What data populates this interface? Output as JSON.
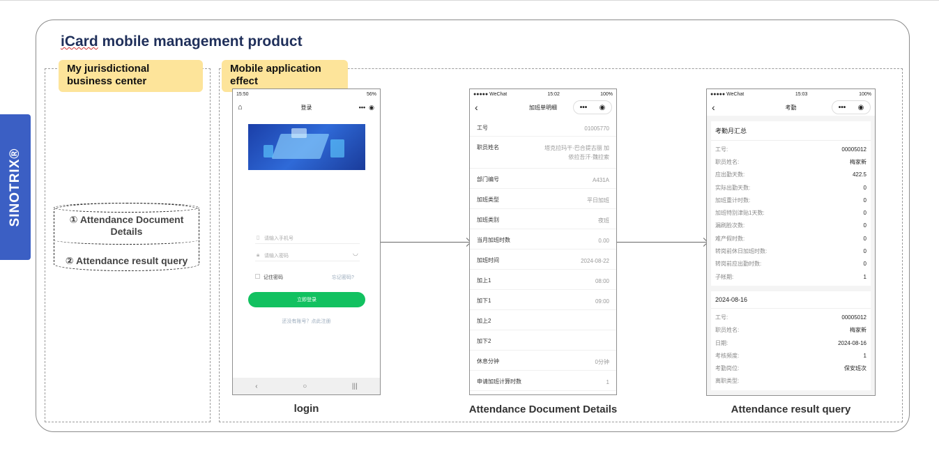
{
  "brand": "SINOTRIX®",
  "title_part1": "iCard",
  "title_part2": " mobile management product",
  "tags": {
    "left": "My jurisdictional business center",
    "right": "Mobile application effect"
  },
  "database": {
    "item1": "① Attendance Document Details",
    "item2": "② Attendance result query"
  },
  "captions": {
    "login": "login",
    "details": "Attendance Document Details",
    "query": "Attendance result query"
  },
  "login_phone": {
    "status_left": "15:50",
    "status_right": "56%",
    "page_title": "登录",
    "phone_placeholder": "请输入手机号",
    "password_placeholder": "请输入密码",
    "remember": "记住密码",
    "forgot": "忘记密码?",
    "login_button": "立即登录",
    "register": "还没有账号？点此注册"
  },
  "details_phone": {
    "carrier": "●●●●● WeChat",
    "time": "15:02",
    "battery": "100%",
    "page_title": "加班单明细",
    "rows": [
      {
        "label": "工号",
        "value": "01005770"
      },
      {
        "label": "职员姓名",
        "value": "塔克拉玛干·巴合提古丽 加依拉吾汗·魏拉索"
      },
      {
        "label": "部门编号",
        "value": "A431A"
      },
      {
        "label": "加班类型",
        "value": "平日加班"
      },
      {
        "label": "加班类别",
        "value": "夜班"
      },
      {
        "label": "当月加班时数",
        "value": "0.00"
      },
      {
        "label": "加班时间",
        "value": "2024-08-22"
      },
      {
        "label": "加上1",
        "value": "08:00"
      },
      {
        "label": "加下1",
        "value": "09:00"
      },
      {
        "label": "加上2",
        "value": ""
      },
      {
        "label": "加下2",
        "value": ""
      },
      {
        "label": "休息分钟",
        "value": "0分钟"
      },
      {
        "label": "申请加班计算时数",
        "value": "1"
      }
    ]
  },
  "query_phone": {
    "carrier": "●●●●● WeChat",
    "time": "15:03",
    "battery": "100%",
    "page_title": "考勤",
    "summary_title": "考勤月汇总",
    "summary": [
      {
        "label": "工号:",
        "value": "00005012"
      },
      {
        "label": "职员姓名:",
        "value": "梅家新"
      },
      {
        "label": "应出勤天数:",
        "value": "422.5"
      },
      {
        "label": "实际出勤天数:",
        "value": "0"
      },
      {
        "label": "加班重计时数:",
        "value": "0"
      },
      {
        "label": "加班特别津贴1天数:",
        "value": "0"
      },
      {
        "label": "漏刷脸次数:",
        "value": "0"
      },
      {
        "label": "难产假时数:",
        "value": "0"
      },
      {
        "label": "转岗前休日加班时数:",
        "value": "0"
      },
      {
        "label": "转岗前应出勤时数:",
        "value": "0"
      },
      {
        "label": "子帐期:",
        "value": "1"
      }
    ],
    "day_title": "2024-08-16",
    "day": [
      {
        "label": "工号:",
        "value": "00005012"
      },
      {
        "label": "职员姓名:",
        "value": "梅家新"
      },
      {
        "label": "日期:",
        "value": "2024-08-16"
      },
      {
        "label": "考核频度:",
        "value": "1"
      },
      {
        "label": "考勤岗位:",
        "value": "保安班次"
      },
      {
        "label": "离职类型:",
        "value": ""
      }
    ]
  }
}
